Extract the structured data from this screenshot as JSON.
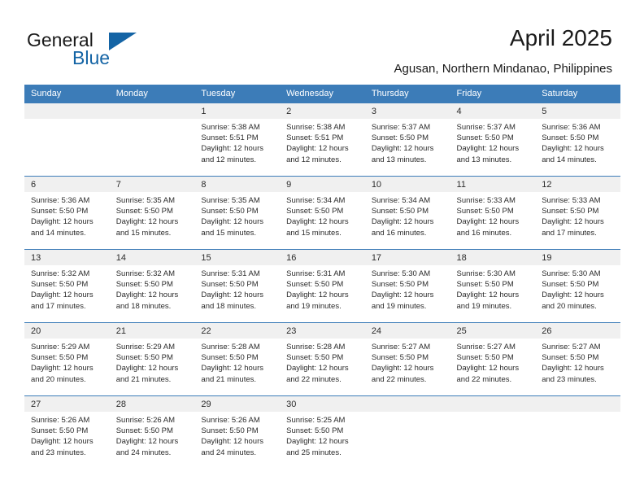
{
  "brand": {
    "name_primary": "General",
    "name_secondary": "Blue"
  },
  "header": {
    "title": "April 2025",
    "subtitle": "Agusan, Northern Mindanao, Philippines"
  },
  "colors": {
    "header_blue": "#3c7cb8",
    "logo_blue": "#1464a5",
    "daynum_band": "#f0f0f0",
    "text": "#2b2b2b"
  },
  "weekday_headers": [
    "Sunday",
    "Monday",
    "Tuesday",
    "Wednesday",
    "Thursday",
    "Friday",
    "Saturday"
  ],
  "weeks": [
    [
      {
        "day": "",
        "blank": true
      },
      {
        "day": "",
        "blank": true
      },
      {
        "day": "1",
        "sunrise": "Sunrise: 5:38 AM",
        "sunset": "Sunset: 5:51 PM",
        "daylight1": "Daylight: 12 hours",
        "daylight2": "and 12 minutes."
      },
      {
        "day": "2",
        "sunrise": "Sunrise: 5:38 AM",
        "sunset": "Sunset: 5:51 PM",
        "daylight1": "Daylight: 12 hours",
        "daylight2": "and 12 minutes."
      },
      {
        "day": "3",
        "sunrise": "Sunrise: 5:37 AM",
        "sunset": "Sunset: 5:50 PM",
        "daylight1": "Daylight: 12 hours",
        "daylight2": "and 13 minutes."
      },
      {
        "day": "4",
        "sunrise": "Sunrise: 5:37 AM",
        "sunset": "Sunset: 5:50 PM",
        "daylight1": "Daylight: 12 hours",
        "daylight2": "and 13 minutes."
      },
      {
        "day": "5",
        "sunrise": "Sunrise: 5:36 AM",
        "sunset": "Sunset: 5:50 PM",
        "daylight1": "Daylight: 12 hours",
        "daylight2": "and 14 minutes."
      }
    ],
    [
      {
        "day": "6",
        "sunrise": "Sunrise: 5:36 AM",
        "sunset": "Sunset: 5:50 PM",
        "daylight1": "Daylight: 12 hours",
        "daylight2": "and 14 minutes."
      },
      {
        "day": "7",
        "sunrise": "Sunrise: 5:35 AM",
        "sunset": "Sunset: 5:50 PM",
        "daylight1": "Daylight: 12 hours",
        "daylight2": "and 15 minutes."
      },
      {
        "day": "8",
        "sunrise": "Sunrise: 5:35 AM",
        "sunset": "Sunset: 5:50 PM",
        "daylight1": "Daylight: 12 hours",
        "daylight2": "and 15 minutes."
      },
      {
        "day": "9",
        "sunrise": "Sunrise: 5:34 AM",
        "sunset": "Sunset: 5:50 PM",
        "daylight1": "Daylight: 12 hours",
        "daylight2": "and 15 minutes."
      },
      {
        "day": "10",
        "sunrise": "Sunrise: 5:34 AM",
        "sunset": "Sunset: 5:50 PM",
        "daylight1": "Daylight: 12 hours",
        "daylight2": "and 16 minutes."
      },
      {
        "day": "11",
        "sunrise": "Sunrise: 5:33 AM",
        "sunset": "Sunset: 5:50 PM",
        "daylight1": "Daylight: 12 hours",
        "daylight2": "and 16 minutes."
      },
      {
        "day": "12",
        "sunrise": "Sunrise: 5:33 AM",
        "sunset": "Sunset: 5:50 PM",
        "daylight1": "Daylight: 12 hours",
        "daylight2": "and 17 minutes."
      }
    ],
    [
      {
        "day": "13",
        "sunrise": "Sunrise: 5:32 AM",
        "sunset": "Sunset: 5:50 PM",
        "daylight1": "Daylight: 12 hours",
        "daylight2": "and 17 minutes."
      },
      {
        "day": "14",
        "sunrise": "Sunrise: 5:32 AM",
        "sunset": "Sunset: 5:50 PM",
        "daylight1": "Daylight: 12 hours",
        "daylight2": "and 18 minutes."
      },
      {
        "day": "15",
        "sunrise": "Sunrise: 5:31 AM",
        "sunset": "Sunset: 5:50 PM",
        "daylight1": "Daylight: 12 hours",
        "daylight2": "and 18 minutes."
      },
      {
        "day": "16",
        "sunrise": "Sunrise: 5:31 AM",
        "sunset": "Sunset: 5:50 PM",
        "daylight1": "Daylight: 12 hours",
        "daylight2": "and 19 minutes."
      },
      {
        "day": "17",
        "sunrise": "Sunrise: 5:30 AM",
        "sunset": "Sunset: 5:50 PM",
        "daylight1": "Daylight: 12 hours",
        "daylight2": "and 19 minutes."
      },
      {
        "day": "18",
        "sunrise": "Sunrise: 5:30 AM",
        "sunset": "Sunset: 5:50 PM",
        "daylight1": "Daylight: 12 hours",
        "daylight2": "and 19 minutes."
      },
      {
        "day": "19",
        "sunrise": "Sunrise: 5:30 AM",
        "sunset": "Sunset: 5:50 PM",
        "daylight1": "Daylight: 12 hours",
        "daylight2": "and 20 minutes."
      }
    ],
    [
      {
        "day": "20",
        "sunrise": "Sunrise: 5:29 AM",
        "sunset": "Sunset: 5:50 PM",
        "daylight1": "Daylight: 12 hours",
        "daylight2": "and 20 minutes."
      },
      {
        "day": "21",
        "sunrise": "Sunrise: 5:29 AM",
        "sunset": "Sunset: 5:50 PM",
        "daylight1": "Daylight: 12 hours",
        "daylight2": "and 21 minutes."
      },
      {
        "day": "22",
        "sunrise": "Sunrise: 5:28 AM",
        "sunset": "Sunset: 5:50 PM",
        "daylight1": "Daylight: 12 hours",
        "daylight2": "and 21 minutes."
      },
      {
        "day": "23",
        "sunrise": "Sunrise: 5:28 AM",
        "sunset": "Sunset: 5:50 PM",
        "daylight1": "Daylight: 12 hours",
        "daylight2": "and 22 minutes."
      },
      {
        "day": "24",
        "sunrise": "Sunrise: 5:27 AM",
        "sunset": "Sunset: 5:50 PM",
        "daylight1": "Daylight: 12 hours",
        "daylight2": "and 22 minutes."
      },
      {
        "day": "25",
        "sunrise": "Sunrise: 5:27 AM",
        "sunset": "Sunset: 5:50 PM",
        "daylight1": "Daylight: 12 hours",
        "daylight2": "and 22 minutes."
      },
      {
        "day": "26",
        "sunrise": "Sunrise: 5:27 AM",
        "sunset": "Sunset: 5:50 PM",
        "daylight1": "Daylight: 12 hours",
        "daylight2": "and 23 minutes."
      }
    ],
    [
      {
        "day": "27",
        "sunrise": "Sunrise: 5:26 AM",
        "sunset": "Sunset: 5:50 PM",
        "daylight1": "Daylight: 12 hours",
        "daylight2": "and 23 minutes."
      },
      {
        "day": "28",
        "sunrise": "Sunrise: 5:26 AM",
        "sunset": "Sunset: 5:50 PM",
        "daylight1": "Daylight: 12 hours",
        "daylight2": "and 24 minutes."
      },
      {
        "day": "29",
        "sunrise": "Sunrise: 5:26 AM",
        "sunset": "Sunset: 5:50 PM",
        "daylight1": "Daylight: 12 hours",
        "daylight2": "and 24 minutes."
      },
      {
        "day": "30",
        "sunrise": "Sunrise: 5:25 AM",
        "sunset": "Sunset: 5:50 PM",
        "daylight1": "Daylight: 12 hours",
        "daylight2": "and 25 minutes."
      },
      {
        "day": "",
        "blank": true
      },
      {
        "day": "",
        "blank": true
      },
      {
        "day": "",
        "blank": true
      }
    ]
  ]
}
